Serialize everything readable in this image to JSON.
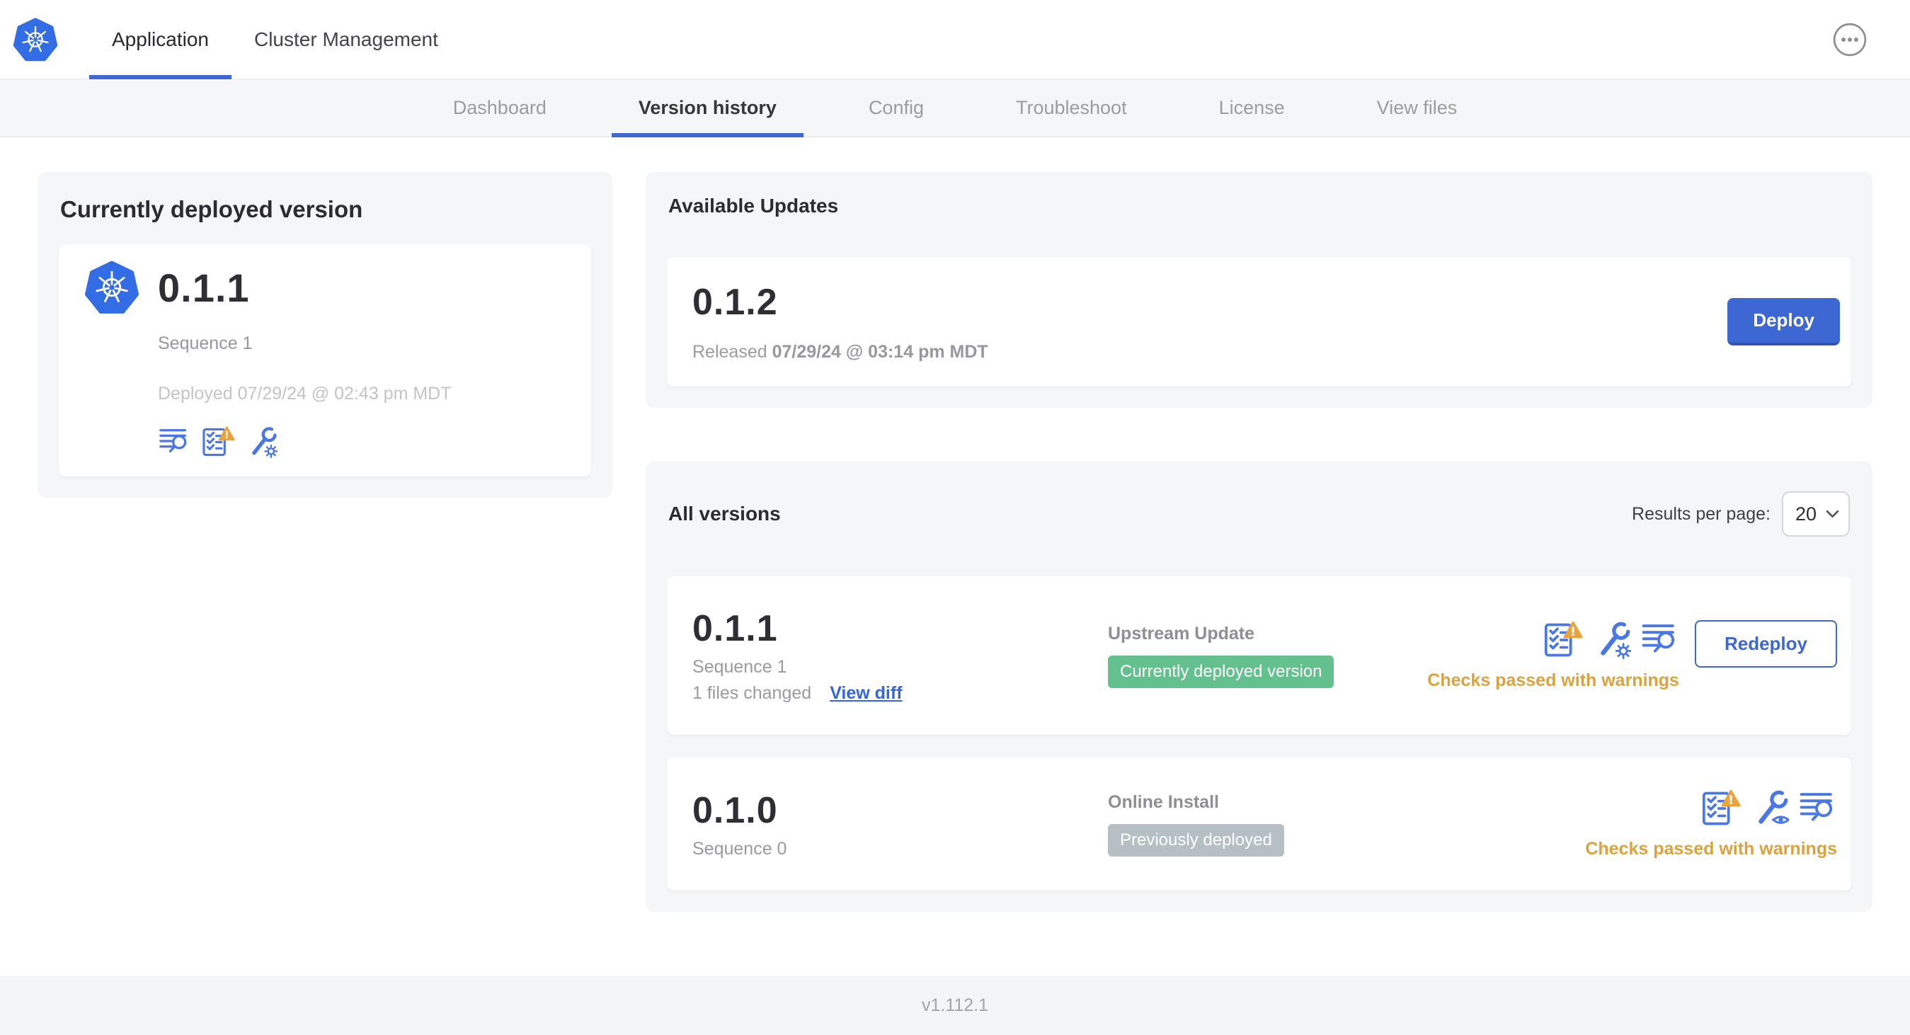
{
  "colors": {
    "accent_blue": "#3d68d3",
    "icon_blue": "#4a77e8",
    "kubernetes_blue": "#326de6",
    "link_blue": "#3366e0",
    "warning_amber": "#e8a33c",
    "checks_text_amber": "#dca23e",
    "green_badge": "#65c08f",
    "gray_badge": "#b5bfc4",
    "card_background": "#f5f6f8"
  },
  "topnav": {
    "tabs": [
      {
        "label": "Application",
        "active": true
      },
      {
        "label": "Cluster Management",
        "active": false
      }
    ]
  },
  "subnav": {
    "tabs": [
      {
        "label": "Dashboard",
        "active": false
      },
      {
        "label": "Version history",
        "active": true
      },
      {
        "label": "Config",
        "active": false
      },
      {
        "label": "Troubleshoot",
        "active": false
      },
      {
        "label": "License",
        "active": false
      },
      {
        "label": "View files",
        "active": false
      }
    ]
  },
  "current_version": {
    "title": "Currently deployed version",
    "version": "0.1.1",
    "sequence": "Sequence 1",
    "deployed": "Deployed 07/29/24 @ 02:43 pm MDT"
  },
  "available_updates": {
    "title": "Available Updates",
    "version": "0.1.2",
    "released_prefix": "Released",
    "released_date": "07/29/24 @ 03:14 pm MDT",
    "deploy_label": "Deploy"
  },
  "all_versions": {
    "title": "All versions",
    "results_per_page_label": "Results per page:",
    "results_per_page_value": "20",
    "rows": [
      {
        "version": "0.1.1",
        "sequence": "Sequence 1",
        "files_changed": "1 files changed",
        "view_diff_label": "View diff",
        "source": "Upstream Update",
        "badge": "Currently deployed version",
        "badge_color": "#65c08f",
        "checks": "Checks passed with warnings",
        "action_label": "Redeploy"
      },
      {
        "version": "0.1.0",
        "sequence": "Sequence 0",
        "source": "Online Install",
        "badge": "Previously deployed",
        "badge_color": "#b5bfc4",
        "checks": "Checks passed with warnings"
      }
    ]
  },
  "footer": {
    "app_version": "v1.112.1"
  }
}
